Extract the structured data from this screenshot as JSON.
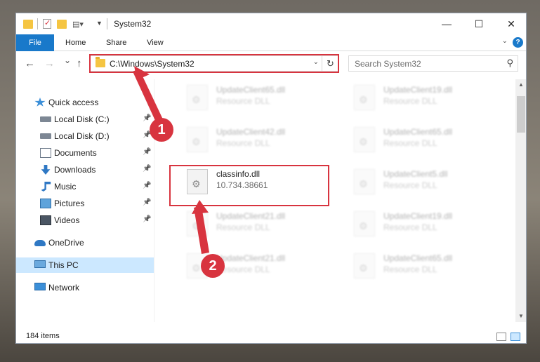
{
  "window": {
    "title": "System32",
    "controls": {
      "minimize": "—",
      "maximize": "☐",
      "close": "✕"
    }
  },
  "ribbon": {
    "tabs": [
      "File",
      "Home",
      "Share",
      "View"
    ],
    "help": "?"
  },
  "navigation": {
    "back": "←",
    "forward": "→",
    "recent": "⌄",
    "up": "↑",
    "address": "C:\\Windows\\System32",
    "refresh": "↻",
    "search_placeholder": "Search System32"
  },
  "sidebar": {
    "items": [
      {
        "label": "Quick access",
        "icon": "star-icon",
        "pinned": false
      },
      {
        "label": "Local Disk (C:)",
        "icon": "drive-icon",
        "pinned": true
      },
      {
        "label": "Local Disk (D:)",
        "icon": "drive-icon",
        "pinned": true
      },
      {
        "label": "Documents",
        "icon": "documents-icon",
        "pinned": true
      },
      {
        "label": "Downloads",
        "icon": "downloads-icon",
        "pinned": true
      },
      {
        "label": "Music",
        "icon": "music-icon",
        "pinned": true
      },
      {
        "label": "Pictures",
        "icon": "pictures-icon",
        "pinned": true
      },
      {
        "label": "Videos",
        "icon": "videos-icon",
        "pinned": true
      },
      {
        "label": "OneDrive",
        "icon": "cloud-icon",
        "pinned": false
      },
      {
        "label": "This PC",
        "icon": "computer-icon",
        "pinned": false,
        "selected": true
      },
      {
        "label": "Network",
        "icon": "network-icon",
        "pinned": false
      }
    ],
    "pin_glyph": "📌"
  },
  "files": [
    {
      "name": "UpdateClient65.dll",
      "type": "Resource DLL",
      "blurred": true
    },
    {
      "name": "UpdateClient19.dll",
      "type": "Resource DLL",
      "blurred": true
    },
    {
      "name": "UpdateClient42.dll",
      "type": "Resource DLL",
      "blurred": true
    },
    {
      "name": "UpdateClient65.dll",
      "type": "Resource DLL",
      "blurred": true
    },
    {
      "name": "classinfo.dll",
      "type": "10.734.38661",
      "blurred": false
    },
    {
      "name": "UpdateClient5.dll",
      "type": "Resource DLL",
      "blurred": true
    },
    {
      "name": "UpdateClient21.dll",
      "type": "Resource DLL",
      "blurred": true
    },
    {
      "name": "UpdateClient19.dll",
      "type": "Resource DLL",
      "blurred": true
    },
    {
      "name": "UpdateClient21.dll",
      "type": "Resource DLL",
      "blurred": true
    },
    {
      "name": "UpdateClient65.dll",
      "type": "Resource DLL",
      "blurred": true
    }
  ],
  "status": {
    "item_count": "184 items"
  },
  "annotations": {
    "step1": "1",
    "step2": "2",
    "color": "#d8343f"
  }
}
